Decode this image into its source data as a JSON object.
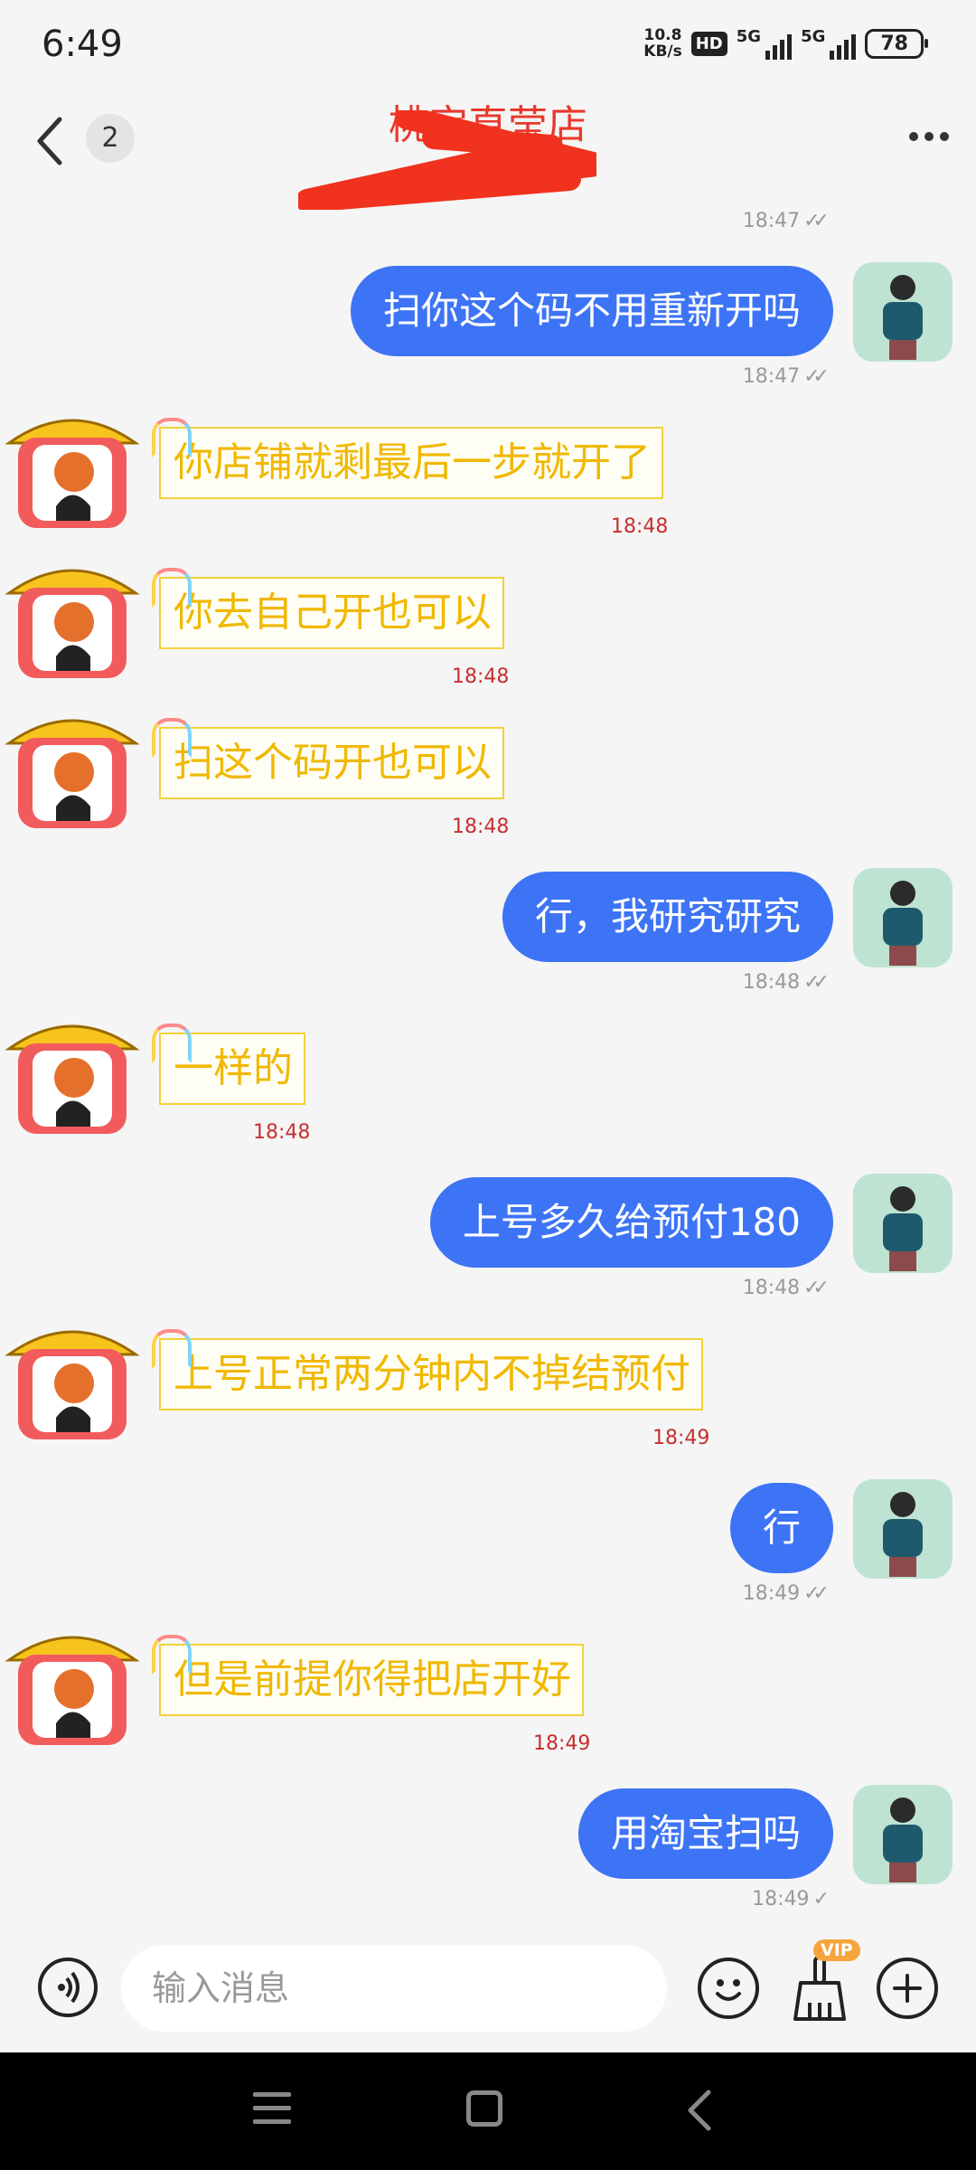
{
  "status": {
    "time": "6:49",
    "net_speed_value": "10.8",
    "net_speed_unit": "KB/s",
    "hd": "HD",
    "sim1": "5G",
    "sim2": "5G",
    "battery": "78"
  },
  "header": {
    "unread_count": "2",
    "title": "桃宝直莹店"
  },
  "messages": [
    {
      "side": "right",
      "text": "扫你这个码不用重新开吗",
      "time": "18:47"
    },
    {
      "side": "left",
      "text": "你店铺就剩最后一步就开了",
      "time": "18:48"
    },
    {
      "side": "left",
      "text": "你去自己开也可以",
      "time": "18:48"
    },
    {
      "side": "left",
      "text": "扫这个码开也可以",
      "time": "18:48"
    },
    {
      "side": "right",
      "text": "行，我研究研究",
      "time": "18:48"
    },
    {
      "side": "left",
      "text": "一样的",
      "time": "18:48"
    },
    {
      "side": "right",
      "text": "上号多久给预付180",
      "time": "18:48"
    },
    {
      "side": "left",
      "text": "上号正常两分钟内不掉结预付",
      "time": "18:49"
    },
    {
      "side": "right",
      "text": "行",
      "time": "18:49"
    },
    {
      "side": "left",
      "text": "但是前提你得把店开好",
      "time": "18:49"
    },
    {
      "side": "right",
      "text": "用淘宝扫吗",
      "time": "18:49"
    }
  ],
  "earlier_time": "18:47",
  "input": {
    "placeholder": "输入消息",
    "vip_label": "VIP"
  },
  "icons": {
    "back": "chevron-left-icon",
    "more": "more-dots-icon",
    "voice": "voice-icon",
    "emoji": "emoji-icon",
    "clean": "broom-icon",
    "plus": "plus-icon"
  },
  "colors": {
    "sent_bubble": "#3d74f5",
    "received_text": "#f0b800",
    "title": "#e8392c",
    "received_time": "#c62f2f"
  }
}
